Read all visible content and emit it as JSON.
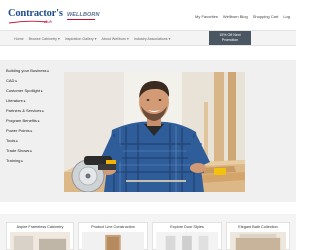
{
  "header": {
    "logo_text": "Contractor's",
    "logo_sub": "club",
    "partner_brand": "WELLBORN",
    "utility_links": [
      "My Favorites",
      "Wellborn Blog",
      "Shopping Cart",
      "Log"
    ]
  },
  "nav": {
    "items": [
      "Home",
      "Browse Cabinetry ▾",
      "Inspiration Gallery ▾",
      "About Wellborn ▾",
      "Industry Associations ▾"
    ],
    "promo_line1": "15% Off Next",
    "promo_line2": "Promotion"
  },
  "sidebar": {
    "items": [
      {
        "label": "Building your Business",
        "arrow": "▸"
      },
      {
        "label": "CAD",
        "arrow": "▸"
      },
      {
        "label": "Customer Spotlight",
        "arrow": "▸"
      },
      {
        "label": "Literature",
        "arrow": "▸"
      },
      {
        "label": "Partners & Services",
        "arrow": "▸"
      },
      {
        "label": "Program Benefits",
        "arrow": "▸"
      },
      {
        "label": "Power Points",
        "arrow": "▸"
      },
      {
        "label": "Tools",
        "arrow": "▸"
      },
      {
        "label": "Trade Shows",
        "arrow": "▸"
      },
      {
        "label": "Training",
        "arrow": "▸"
      }
    ]
  },
  "cards": [
    {
      "title": "Aspire Frameless Cabinetry"
    },
    {
      "title": "Product Line Construction"
    },
    {
      "title": "Explore Door Styles"
    },
    {
      "title": "Elegant Bath Collection"
    }
  ],
  "colors": {
    "brand_blue": "#1f4e8c",
    "brand_red": "#c8102e",
    "promo_bg": "#4a5661",
    "shirt_blue": "#2f5d9a"
  }
}
